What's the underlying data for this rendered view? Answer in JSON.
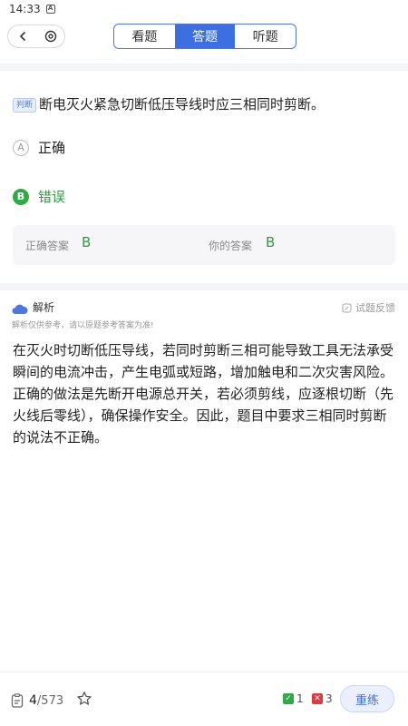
{
  "status_bar": {
    "time": "14:33",
    "icon": "A"
  },
  "nav": {
    "back_icon": "chevron-left-icon",
    "settings_icon": "target-icon",
    "tabs": [
      {
        "label": "看题",
        "active": false
      },
      {
        "label": "答题",
        "active": true
      },
      {
        "label": "听题",
        "active": false
      }
    ]
  },
  "question": {
    "type_badge": "判断",
    "text": "断电灭火紧急切断低压导线时应三相同时剪断。",
    "options": [
      {
        "letter": "A",
        "label": "正确",
        "state": "normal"
      },
      {
        "letter": "B",
        "label": "错误",
        "state": "correct"
      }
    ],
    "answer": {
      "correct_label": "正确答案",
      "correct_value": "B",
      "yours_label": "你的答案",
      "yours_value": "B"
    }
  },
  "analysis": {
    "title": "解析",
    "feedback_label": "试题反馈",
    "note": "解析仅供参考，请以原题参考答案为准!",
    "text": "在灭火时切断低压导线，若同时剪断三相可能导致工具无法承受瞬间的电流冲击，产生电弧或短路，增加触电和二次灾害风险。正确的做法是先断开电源总开关，若必须剪线，应逐根切断（先火线后零线），确保操作安全。因此，题目中要求三相同时剪断的说法不正确。"
  },
  "bottom": {
    "current": "4",
    "total": "/573",
    "correct_count": "1",
    "wrong_count": "3",
    "retry_label": "重练"
  },
  "colors": {
    "accent": "#3d6fe0",
    "correct": "#2faa45",
    "wrong": "#e0393e"
  }
}
